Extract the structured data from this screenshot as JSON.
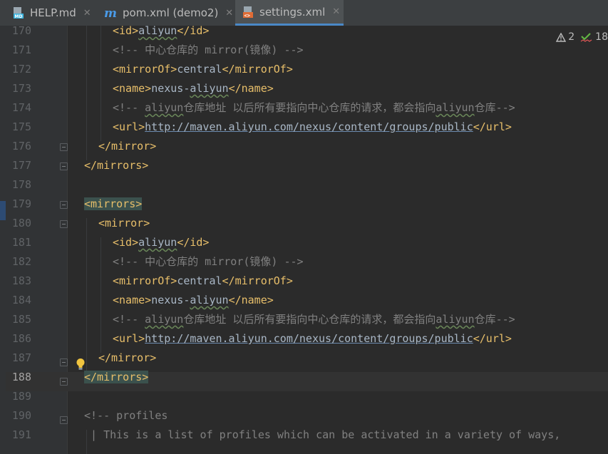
{
  "tabs": [
    {
      "label": "HELP.md",
      "icon": "markdown-file-icon",
      "active": false
    },
    {
      "label": "pom.xml (demo2)",
      "icon": "maven-m-icon",
      "active": false
    },
    {
      "label": "settings.xml",
      "icon": "xml-file-icon",
      "active": true
    }
  ],
  "tab_close_glyph": "✕",
  "inspections": {
    "warnings": "2",
    "weak_warnings": "18"
  },
  "lines": [
    {
      "num": "170"
    },
    {
      "num": "171"
    },
    {
      "num": "172"
    },
    {
      "num": "173"
    },
    {
      "num": "174"
    },
    {
      "num": "175"
    },
    {
      "num": "176"
    },
    {
      "num": "177"
    },
    {
      "num": "178"
    },
    {
      "num": "179"
    },
    {
      "num": "180"
    },
    {
      "num": "181"
    },
    {
      "num": "182"
    },
    {
      "num": "183"
    },
    {
      "num": "184"
    },
    {
      "num": "185"
    },
    {
      "num": "186"
    },
    {
      "num": "187"
    },
    {
      "num": "188"
    },
    {
      "num": "189"
    },
    {
      "num": "190"
    },
    {
      "num": "191"
    }
  ],
  "code": {
    "l170": {
      "open": "<id>",
      "text": "aliyun",
      "close": "</id>"
    },
    "l171": {
      "comment": "<!-- 中心仓库的 mirror(镜像) -->"
    },
    "l172": {
      "open": "<mirrorOf>",
      "text": "central",
      "close": "</mirrorOf>"
    },
    "l173": {
      "open": "<name>",
      "text_a": "nexus-",
      "text_b": "aliyun",
      "close": "</name>"
    },
    "l174": {
      "c1": "<!-- ",
      "c2": "aliyun",
      "c3": "仓库地址 以后所有要指向中心仓库的请求，都会指向",
      "c4": "aliyun",
      "c5": "仓库-->"
    },
    "l175": {
      "open": "<url>",
      "text": "http://maven.aliyun.com/nexus/content/groups/public",
      "close": "</url>"
    },
    "l176": {
      "tag": "</mirror>"
    },
    "l177": {
      "tag": "</mirrors>"
    },
    "l179": {
      "tag": "<mirrors>"
    },
    "l180": {
      "tag": "<mirror>"
    },
    "l181": {
      "open": "<id>",
      "text": "aliyun",
      "close": "</id>"
    },
    "l182": {
      "comment": "<!-- 中心仓库的 mirror(镜像) -->"
    },
    "l183": {
      "open": "<mirrorOf>",
      "text": "central",
      "close": "</mirrorOf>"
    },
    "l184": {
      "open": "<name>",
      "text_a": "nexus-",
      "text_b": "aliyun",
      "close": "</name>"
    },
    "l185": {
      "c1": "<!-- ",
      "c2": "aliyun",
      "c3": "仓库地址 以后所有要指向中心仓库的请求，都会指向",
      "c4": "aliyun",
      "c5": "仓库-->"
    },
    "l186": {
      "open": "<url>",
      "text": "http://maven.aliyun.com/nexus/content/groups/public",
      "close": "</url>"
    },
    "l187": {
      "tag": "</mirror>"
    },
    "l188": {
      "tag": "</mirrors>"
    },
    "l190": {
      "comment": "<!-- profiles"
    },
    "l191": {
      "comment": " | This is a list of profiles which can be activated in a variety of ways,"
    }
  },
  "colors": {
    "tag": "#e8bf6a",
    "comment": "#808080",
    "text": "#a9b7c6",
    "match_highlight": "#3b514d"
  }
}
